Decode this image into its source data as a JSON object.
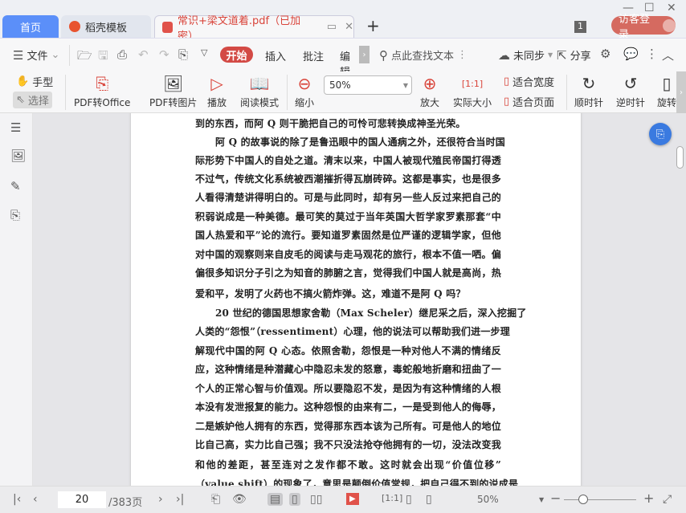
{
  "tabs": [
    {
      "label": "首页",
      "icon": "home"
    },
    {
      "label": "稻壳模板",
      "icon": "docer-logo-icon"
    },
    {
      "label": "常识+梁文道着.pdf（已加密）",
      "icon": "pdf-icon"
    }
  ],
  "window_badge": "1",
  "login_label": "访客登录",
  "menu": {
    "file": "文件",
    "start": "开始",
    "insert": "插入",
    "annotate": "批注",
    "edit": "编辑",
    "search_placeholder": "点此查找文本",
    "sync": "未同步",
    "share": "分享"
  },
  "tools": {
    "hand": "手型",
    "select": "选择",
    "pdf_office": "PDF转Office",
    "pdf_image": "PDF转图片",
    "play": "播放",
    "read_mode": "阅读模式",
    "zoom_out": "缩小",
    "zoom_value": "50%",
    "zoom_in": "放大",
    "actual_size": "实际大小",
    "fit_width": "适合宽度",
    "fit_page": "适合页面",
    "clockwise": "顺时针",
    "counterclockwise": "逆时针",
    "rotate": "旋转"
  },
  "document": {
    "lines": [
      {
        "t": "到的东西，而阿 Q 则干脆把自己的可怜可悲转换成神圣光荣。",
        "last": true
      },
      {
        "t": "阿 Q 的故事说的除了是鲁迅眼中的国人通病之外，还很符合当时国",
        "ind": true
      },
      {
        "t": "际形势下中国人的自处之道。清末以来，中国人被现代殖民帝国打得透"
      },
      {
        "t": "不过气，传统文化系统被西潮摧折得瓦崩砖碎。这都是事实，也是很多"
      },
      {
        "t": "人看得清楚讲得明白的。可是与此同时，却有另一些人反过来把自己的"
      },
      {
        "t": "积弱说成是一种美德。最可笑的莫过于当年英国大哲学家罗素那套“中"
      },
      {
        "t": "国人热爱和平”论的流行。要知道罗素固然是位严谨的逻辑学家，但他"
      },
      {
        "t": "对中国的观察则来自皮毛的阅读与走马观花的旅行，根本不值一哂。偏"
      },
      {
        "t": "偏很多知识分子引之为知音的肺腑之言，觉得我们中国人就是高尚，热"
      },
      {
        "t": "爱和平，发明了火药也不搞火箭炸弹。这，难道不是阿 Q 吗？",
        "last": true
      },
      {
        "t": "20 世纪的德国思想家舍勒（Max Scheler）继尼采之后，深入挖掘了",
        "ind": true
      },
      {
        "t": "人类的“怨恨”（ressentiment）心理，他的说法可以帮助我们进一步理"
      },
      {
        "t": "解现代中国的阿 Q 心态。依照舍勒，怨恨是一种对他人不满的情绪反"
      },
      {
        "t": "应，这种情绪是种潜藏心中隐忍未发的怒意，毒蛇般地折磨和扭曲了一"
      },
      {
        "t": "个人的正常心智与价值观。所以要隐忍不发，是因为有这种情绪的人根"
      },
      {
        "t": "本没有发泄报复的能力。这种怨恨的由来有二，一是受到他人的侮辱，"
      },
      {
        "t": "二是嫉妒他人拥有的东西，觉得那东西本该为己所有。可是他人的地位"
      },
      {
        "t": "比自己高，实力比自己强；我不只没法抢夺他拥有的一切，没法改变我"
      },
      {
        "t": "和他的差距，甚至连对之发作都不敢。这时就会出现“价值位移”"
      },
      {
        "t": "（value shift）的现象了，意思是颠倒价值常规，把自己得不到的说成是"
      }
    ]
  },
  "statusbar": {
    "page": "20",
    "total": "/383页",
    "zoom": "50%",
    "zoom_fraction": 0.27
  },
  "colors": {
    "accent": "#d34a45",
    "home_tab": "#5b8ff9",
    "fab": "#3a7ae0"
  }
}
